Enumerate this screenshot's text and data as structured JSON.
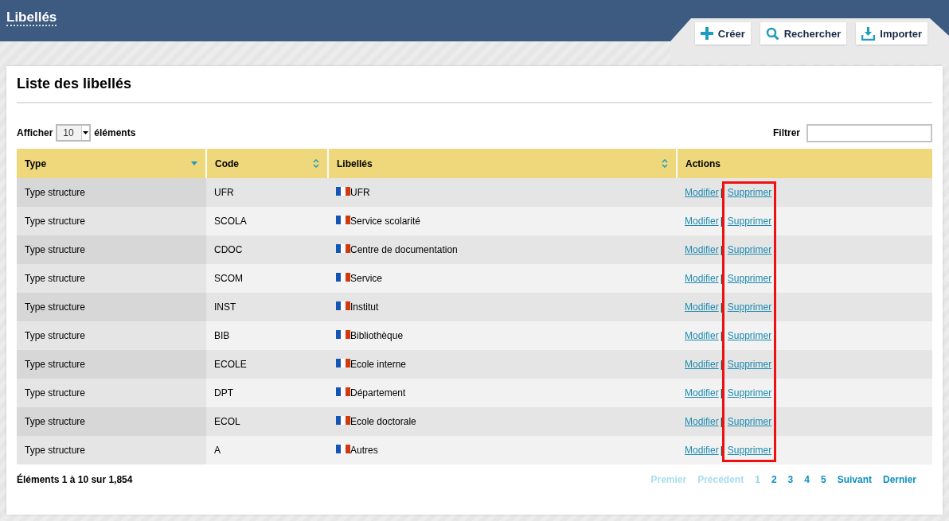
{
  "header": {
    "title": "Libellés"
  },
  "toolbar": [
    {
      "kind": "create",
      "label": "Créer"
    },
    {
      "kind": "search",
      "label": "Rechercher"
    },
    {
      "kind": "import",
      "label": "Importer"
    }
  ],
  "panel": {
    "title": "Liste des libellés"
  },
  "length_control": {
    "before": "Afficher",
    "value": "10",
    "after": "éléments"
  },
  "filter": {
    "label": "Filtrer"
  },
  "table": {
    "columns": [
      {
        "label": "Type",
        "sortable": true,
        "sorted": true
      },
      {
        "label": "Code",
        "sortable": true,
        "sorted": false
      },
      {
        "label": "Libellés",
        "sortable": true,
        "sorted": false
      },
      {
        "label": "Actions",
        "sortable": false,
        "sorted": false
      }
    ],
    "rows": [
      {
        "type": "Type structure",
        "code": "UFR",
        "label": "UFR",
        "edit": "Modifier",
        "separator": "|",
        "delete": "Supprimer"
      },
      {
        "type": "Type structure",
        "code": "SCOLA",
        "label": "Service scolarité",
        "edit": "Modifier",
        "separator": "|",
        "delete": "Supprimer"
      },
      {
        "type": "Type structure",
        "code": "CDOC",
        "label": "Centre de documentation",
        "edit": "Modifier",
        "separator": "|",
        "delete": "Supprimer"
      },
      {
        "type": "Type structure",
        "code": "SCOM",
        "label": "Service",
        "edit": "Modifier",
        "separator": "|",
        "delete": "Supprimer"
      },
      {
        "type": "Type structure",
        "code": "INST",
        "label": "Institut",
        "edit": "Modifier",
        "separator": "|",
        "delete": "Supprimer"
      },
      {
        "type": "Type structure",
        "code": "BIB",
        "label": "Bibliothèque",
        "edit": "Modifier",
        "separator": "|",
        "delete": "Supprimer"
      },
      {
        "type": "Type structure",
        "code": "ECOLE",
        "label": "Ecole interne",
        "edit": "Modifier",
        "separator": "|",
        "delete": "Supprimer"
      },
      {
        "type": "Type structure",
        "code": "DPT",
        "label": "Département",
        "edit": "Modifier",
        "separator": "|",
        "delete": "Supprimer"
      },
      {
        "type": "Type structure",
        "code": "ECOL",
        "label": "Ecole doctorale",
        "edit": "Modifier",
        "separator": "|",
        "delete": "Supprimer"
      },
      {
        "type": "Type structure",
        "code": "A",
        "label": "Autres",
        "edit": "Modifier",
        "separator": "|",
        "delete": "Supprimer"
      }
    ],
    "delete_links_highlighted": true
  },
  "info": "Éléments 1 à 10 sur 1,854",
  "pagination": [
    {
      "label": "Premier",
      "disabled": true,
      "selected": false
    },
    {
      "label": "Précédent",
      "disabled": true,
      "selected": false
    },
    {
      "label": "1",
      "disabled": false,
      "selected": true
    },
    {
      "label": "2",
      "disabled": false,
      "selected": false
    },
    {
      "label": "3",
      "disabled": false,
      "selected": false
    },
    {
      "label": "4",
      "disabled": false,
      "selected": false
    },
    {
      "label": "5",
      "disabled": false,
      "selected": false
    },
    {
      "label": "Suivant",
      "disabled": false,
      "selected": false
    },
    {
      "label": "Dernier",
      "disabled": false,
      "selected": false
    }
  ]
}
